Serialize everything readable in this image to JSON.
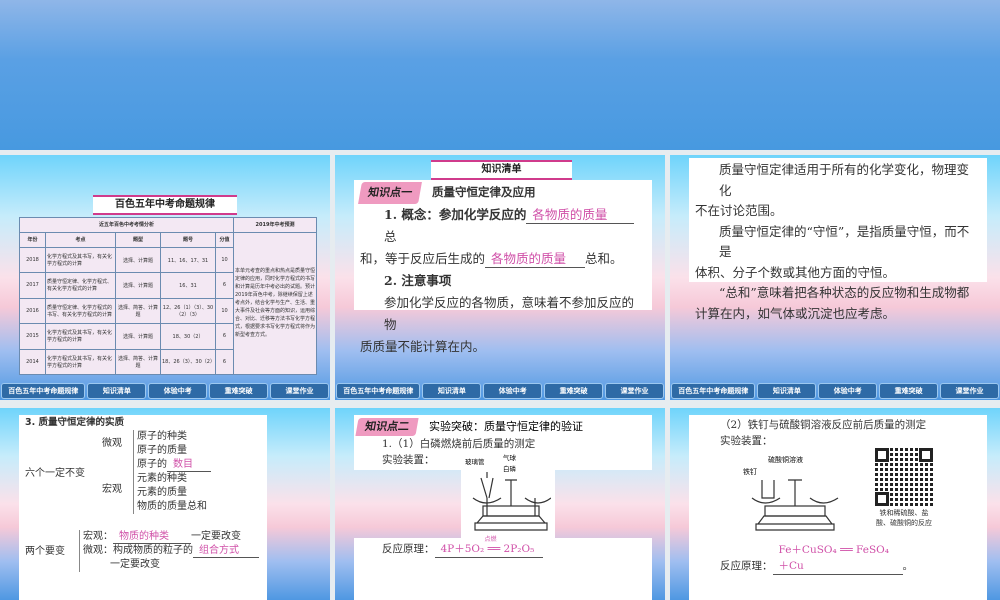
{
  "nav": [
    "百色五年中考命题规律",
    "知识清单",
    "体验中考",
    "重难突破",
    "课堂作业"
  ],
  "s1": {
    "title": "百色五年中考命题规律",
    "table_caption": "近五年百色中考考情分析",
    "pred_caption": "2019年中考预测",
    "headers": [
      "年份",
      "考点",
      "题型",
      "题号",
      "分值"
    ],
    "rows": [
      [
        "2018",
        "化学方程式及其书写，有关化学方程式的计算",
        "选择、计算题",
        "11、16、17、31",
        "10"
      ],
      [
        "2017",
        "质量守恒定律、化学方程式、有关化学方程式的计算",
        "选择、计算题",
        "16、31",
        "6"
      ],
      [
        "2016",
        "质量守恒定律、化学方程式的书写、有关化学方程式的计算",
        "选择、简答、计算题",
        "12、26（1）（3）、30（2）（3）",
        "10"
      ],
      [
        "2015",
        "化学方程式及其书写，有关化学方程式的计算",
        "选择、计算题",
        "18、30（2）",
        "6"
      ],
      [
        "2014",
        "化学方程式及其书写，有关化学方程式的计算",
        "选择、简答、计算题",
        "18、26（3）、30（2）",
        "6"
      ]
    ],
    "prediction": "本单元考查的重点和热点是质量守恒定律的应用，同时化学方程式的书写和计算是历年中考必出的试题。预计2019年百色中考，除继续保留上述考点外，结合化学与生产、生活、重大事件及社会等方面的知识，运用综合、对比、迁移等方法书写化学方程式，根据要求书写化学方程式将作为新型考查方式。"
  },
  "s2": {
    "title": "知识清单",
    "kp": "知识点一",
    "kp_title": "质量守恒定律及应用",
    "l1a": "1. 概念：参加化学反应的",
    "ans1": "各物质的质量",
    "l1b": "总",
    "l2a": "和，等于反应后生成的",
    "ans2": "各物质的质量",
    "l2b": "总和。",
    "h2": "2. 注意事项",
    "p1": "参加化学反应的各物质，意味着不参加反应的物",
    "p2": "质质量不能计算在内。"
  },
  "s3": {
    "p": [
      "质量守恒定律适用于所有的化学变化，物理变化",
      "不在讨论范围。",
      "质量守恒定律的“守恒”，是指质量守恒，而不是",
      "体积、分子个数或其他方面的守恒。",
      "“总和”意味着把各种状态的反应物和生成物都",
      "计算在内，如气体或沉淀也应考虑。"
    ]
  },
  "s4": {
    "h": "3. 质量守恒定律的实质",
    "six": "六个一定不变",
    "micro": "微观",
    "macro": "宏观",
    "m1": "原子的种类",
    "m2": "原子的质量",
    "m3": "原子的",
    "m3ans": "数目",
    "a1": "元素的种类",
    "a2": "元素的质量",
    "a3": "物质的质量总和",
    "two": "两个要变",
    "t1": "宏观：",
    "t1ans": "物质的种类",
    "t1b": "一定要改变",
    "t2": "微观：",
    "t2a": "构成物质的粒子的",
    "t2ans": "组合方式",
    "t2b": "一定要改变"
  },
  "s5": {
    "kp": "知识点二",
    "kp_title": "实验突破：质量守恒定律的验证",
    "l1": "1.（1）白磷燃烧前后质量的测定",
    "l2": "实验装置：",
    "lab1": "玻璃管",
    "lab2": "气球",
    "lab3": "白磷",
    "l3": "反应原理：",
    "eq": "4P＋5O₂ ══ 2P₂O₅",
    "cond": "点燃"
  },
  "s6": {
    "l1": "（2）铁钉与硫酸铜溶液反应前后质量的测定",
    "l2": "实验装置：",
    "lab1": "铁钉",
    "lab2": "硫酸铜溶液",
    "qr_caption": "铁和稀硫酸、盐酸、硫酸铜的反应",
    "l3": "反应原理：",
    "eq": "Fe＋CuSO₄ ══ FeSO₄＋Cu",
    "end": "。"
  }
}
